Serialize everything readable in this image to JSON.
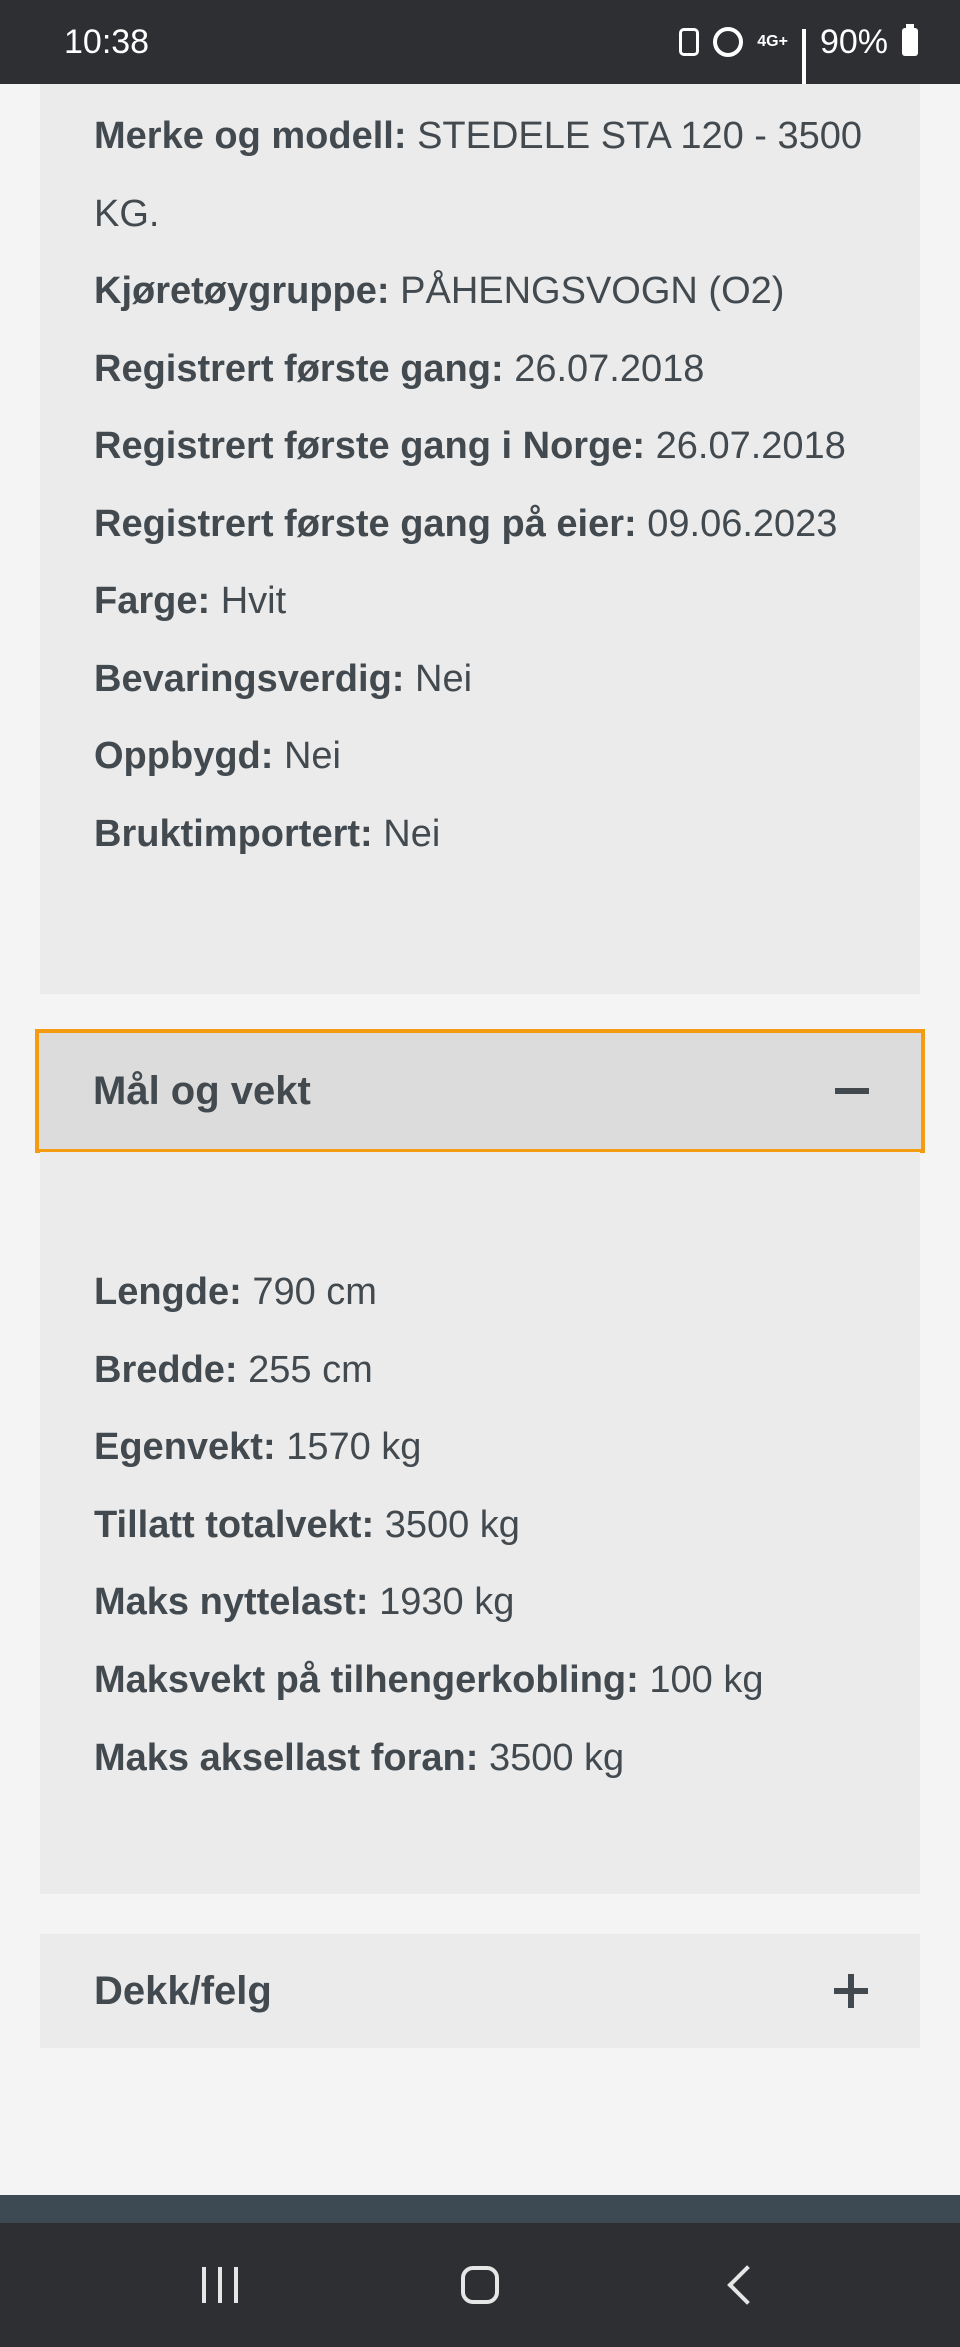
{
  "status_bar": {
    "time": "10:38",
    "network": "4G+",
    "battery": "90%"
  },
  "vehicle_info": {
    "rows": [
      {
        "label": "Merke og modell:",
        "value": "STEDELE STA 120 - 3500"
      },
      {
        "label": "",
        "value": "KG."
      },
      {
        "label": "Kjøretøygruppe:",
        "value": "PÅHENGSVOGN (O2)"
      },
      {
        "label": "Registrert første gang:",
        "value": "26.07.2018"
      },
      {
        "label": "Registrert første gang i Norge:",
        "value": "26.07.2018"
      },
      {
        "label": "Registrert første gang på eier:",
        "value": "09.06.2023"
      },
      {
        "label": "Farge:",
        "value": "Hvit"
      },
      {
        "label": "Bevaringsverdig:",
        "value": "Nei"
      },
      {
        "label": "Oppbygd:",
        "value": "Nei"
      },
      {
        "label": "Bruktimportert:",
        "value": "Nei"
      }
    ]
  },
  "dimensions": {
    "title": "Mål og vekt",
    "rows": [
      {
        "label": "Lengde:",
        "value": "790 cm"
      },
      {
        "label": "Bredde:",
        "value": "255 cm"
      },
      {
        "label": "Egenvekt:",
        "value": "1570 kg"
      },
      {
        "label": "Tillatt totalvekt:",
        "value": "3500 kg"
      },
      {
        "label": "Maks nyttelast:",
        "value": "1930 kg"
      },
      {
        "label": "Maksvekt på tilhengerkobling:",
        "value": "100 kg"
      },
      {
        "label": "Maks aksellast foran:",
        "value": "3500 kg"
      }
    ]
  },
  "tires": {
    "title": "Dekk/felg"
  }
}
